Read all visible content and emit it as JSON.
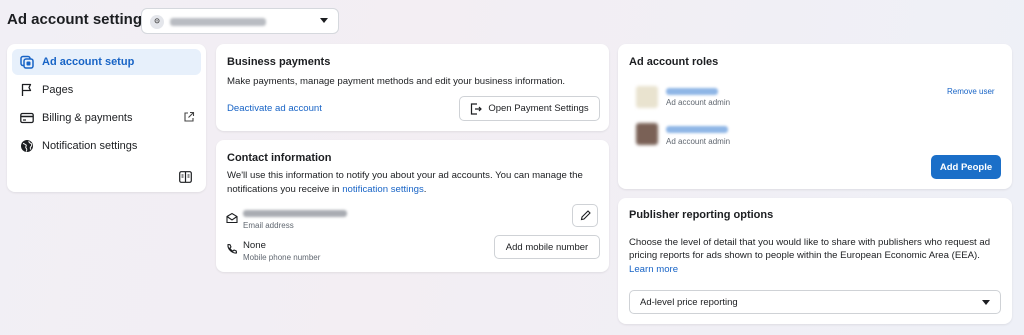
{
  "page": {
    "title": "Ad account settings"
  },
  "account_selector": {
    "badge": "⊙"
  },
  "nav": {
    "items": [
      {
        "label": "Ad account setup",
        "icon": "ad-account-icon",
        "active": true
      },
      {
        "label": "Pages",
        "icon": "flag-icon"
      },
      {
        "label": "Billing & payments",
        "icon": "credit-card-icon",
        "external": true
      },
      {
        "label": "Notification settings",
        "icon": "globe-icon"
      }
    ],
    "collapse_icon": "sidebar-collapse-icon"
  },
  "business_payments": {
    "title": "Business payments",
    "description": "Make payments, manage payment methods and edit your business information.",
    "deactivate_link": "Deactivate ad account",
    "open_button": "Open Payment Settings"
  },
  "contact": {
    "title": "Contact information",
    "description_1": "We'll use this information to notify you about your ad accounts. You can manage the notifications you receive in ",
    "description_link": "notification settings",
    "description_2": ".",
    "email_label": "Email address",
    "phone_value": "None",
    "phone_label": "Mobile phone number",
    "add_mobile_button": "Add mobile number"
  },
  "roles": {
    "title": "Ad account roles",
    "users": [
      {
        "role": "Ad account admin",
        "action": "Remove user"
      },
      {
        "role": "Ad account admin"
      }
    ],
    "add_button": "Add People"
  },
  "publisher": {
    "title": "Publisher reporting options",
    "description": "Choose the level of detail that you would like to share with publishers who request ad pricing reports for ads shown to people within the European Economic Area (EEA).",
    "learn_more": "Learn more",
    "select_value": "Ad-level price reporting"
  },
  "colors": {
    "accent": "#1864c6",
    "primary_button": "#1b6fc8",
    "active_nav_bg": "#e7f0fb"
  }
}
